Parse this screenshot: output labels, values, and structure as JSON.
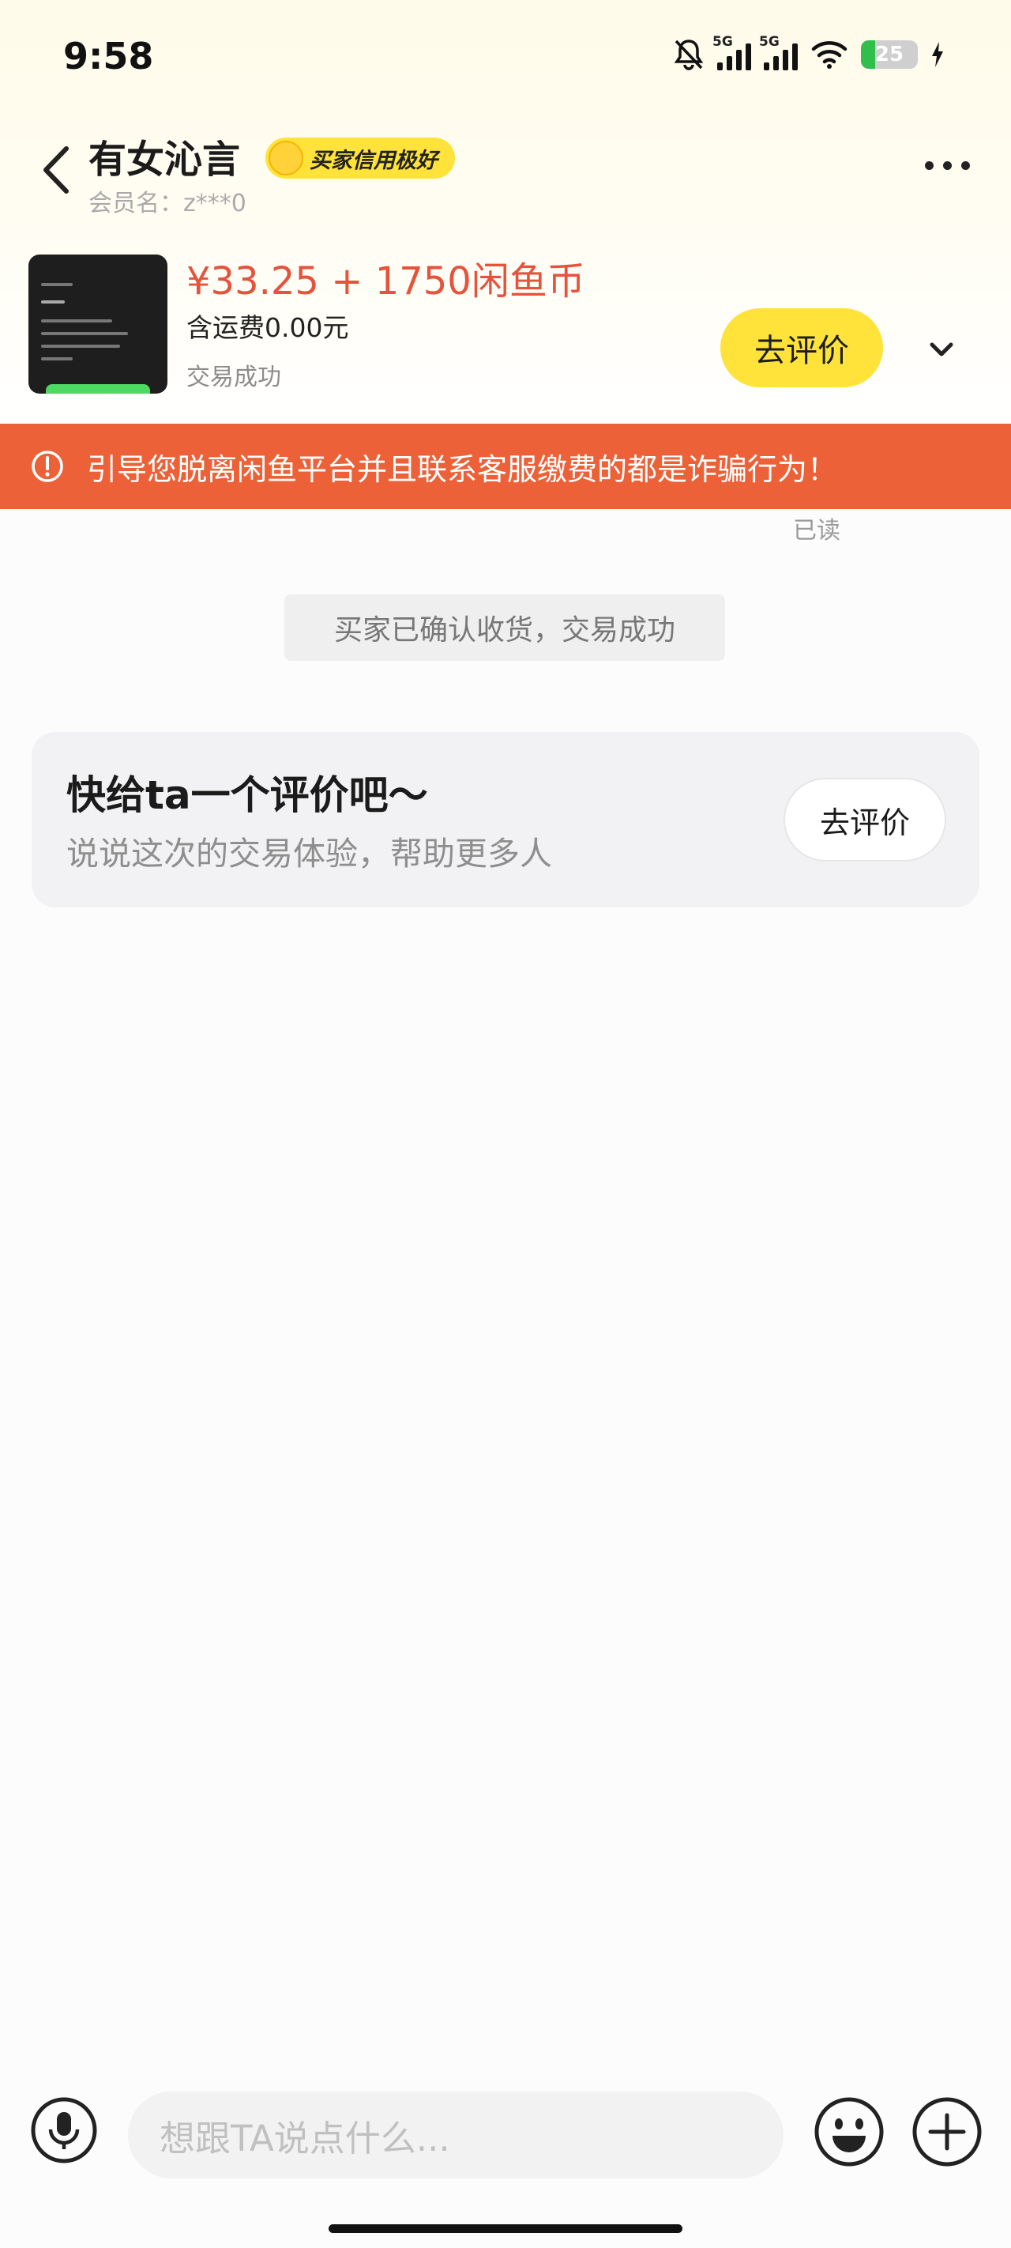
{
  "status_bar": {
    "time": "9:58",
    "network_1": "5G",
    "network_2": "5G",
    "battery_level": "25",
    "battery_fraction": 0.25,
    "icons": [
      "bell-muted-icon",
      "signal-icon",
      "signal-icon",
      "wifi-icon",
      "battery-icon",
      "charging-icon"
    ]
  },
  "header": {
    "name": "有女沁言",
    "badge": "买家信用极好",
    "member_label": "会员名：z***0",
    "icons": [
      "back-icon",
      "more-icon"
    ]
  },
  "product": {
    "price": "¥33.25 + 1750闲鱼币",
    "shipping": "含运费0.00元",
    "status": "交易成功",
    "action": "去评价",
    "icons": [
      "chevron-down-icon"
    ]
  },
  "warning": {
    "text": "引导您脱离闲鱼平台并且联系客服缴费的都是诈骗行为！",
    "icon": "alert-circle-icon"
  },
  "chat": {
    "read_receipt": "已读",
    "system_message": "买家已确认收货，交易成功",
    "review_prompt": {
      "title": "快给ta一个评价吧～",
      "subtitle": "说说这次的交易体验，帮助更多人",
      "button": "去评价"
    }
  },
  "input_bar": {
    "placeholder": "想跟TA说点什么...",
    "icons": [
      "microphone-icon",
      "emoji-icon",
      "plus-icon"
    ]
  },
  "colors": {
    "accent_yellow": "#ffe23a",
    "warning_orange": "#ec6138",
    "price_red": "#e5533c"
  }
}
